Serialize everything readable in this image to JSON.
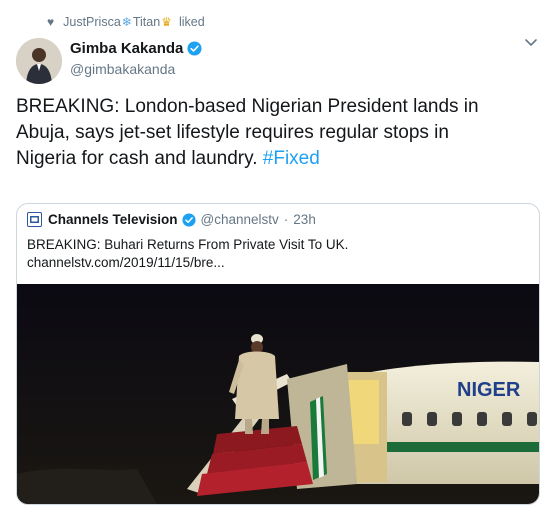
{
  "liked_by": {
    "user1": "JustPrisca",
    "user2": "Titan",
    "action": "liked"
  },
  "tweet": {
    "author_name": "Gimba Kakanda",
    "author_handle": "@gimbakakanda",
    "text_line1": "BREAKING: London-based Nigerian President lands in",
    "text_line2": "Abuja, says jet-set lifestyle requires regular stops in",
    "text_line3": "Nigeria for cash and laundry.",
    "hashtag": "#Fixed"
  },
  "quoted_tweet": {
    "author_name": "Channels Television",
    "author_handle": "@channelstv",
    "time": "23h",
    "headline": "BREAKING: Buhari Returns From Private Visit To UK.",
    "link": "channelstv.com/2019/11/15/bre...",
    "aircraft_text": "NIGER"
  },
  "colors": {
    "accent": "#1da1f2",
    "muted": "#657786",
    "border": "#ccd6dd"
  },
  "icons": [
    "heart-icon",
    "snowflake-icon",
    "crown-icon",
    "verified-badge-icon",
    "chevron-down-icon",
    "channels-logo-icon"
  ]
}
